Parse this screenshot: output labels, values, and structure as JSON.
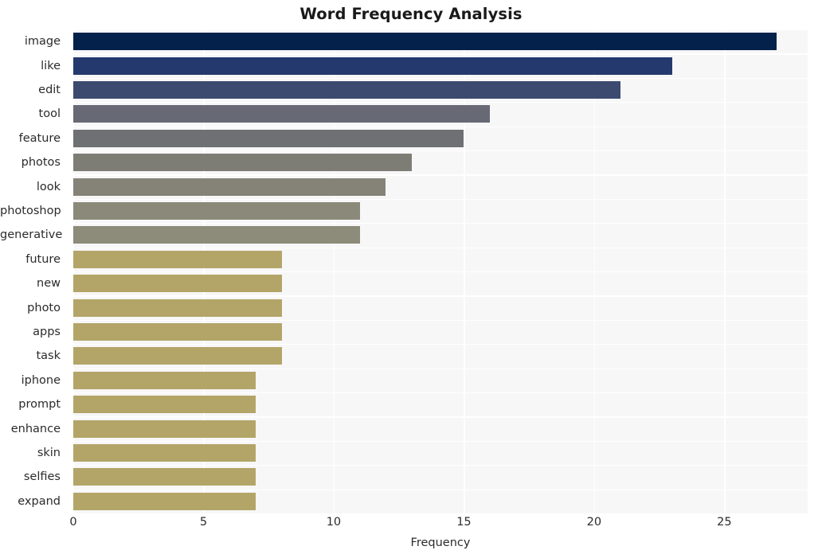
{
  "chart_data": {
    "type": "bar",
    "orientation": "horizontal",
    "title": "Word Frequency Analysis",
    "xlabel": "Frequency",
    "ylabel": "",
    "xlim": [
      0,
      28.2
    ],
    "ylim": [
      0,
      20
    ],
    "grid": true,
    "legend": null,
    "xticks": [
      0,
      5,
      10,
      15,
      20,
      25
    ],
    "xtick_labels": [
      "0",
      "5",
      "10",
      "15",
      "20",
      "25"
    ],
    "categories": [
      "image",
      "like",
      "edit",
      "tool",
      "feature",
      "photos",
      "look",
      "photoshop",
      "generative",
      "future",
      "new",
      "photo",
      "apps",
      "task",
      "iphone",
      "prompt",
      "enhance",
      "skin",
      "selfies",
      "expand"
    ],
    "values": [
      27,
      23,
      21,
      16,
      15,
      13,
      12,
      11,
      11,
      8,
      8,
      8,
      8,
      8,
      7,
      7,
      7,
      7,
      7,
      7
    ],
    "bar_colors": [
      "#03214a",
      "#24396e",
      "#3d4a70",
      "#676a75",
      "#6f7073",
      "#7e7d75",
      "#858377",
      "#8b8979",
      "#8d8b79",
      "#b3a568",
      "#b3a568",
      "#b3a568",
      "#b3a568",
      "#b3a568",
      "#b3a568",
      "#b3a568",
      "#b3a568",
      "#b3a568",
      "#b3a568",
      "#b3a568"
    ],
    "plot_background": "#f7f7f8",
    "grid_color": "#ffffff",
    "figure_background": "#ffffff"
  }
}
